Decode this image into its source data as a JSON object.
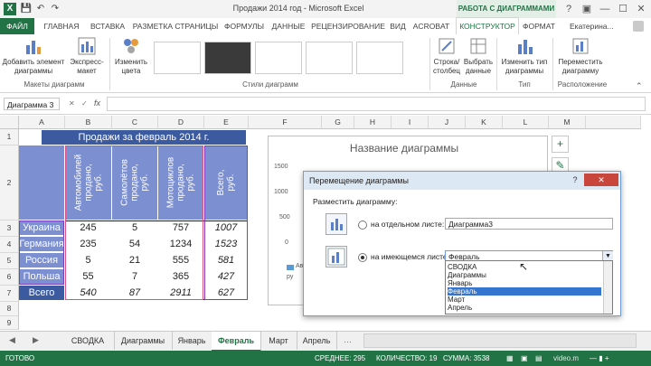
{
  "title_bar": {
    "app_icon": "X",
    "doc_title": "Продажи 2014 год - Microsoft Excel",
    "tools_title": "РАБОТА С ДИАГРАММАМИ",
    "help_icon": "?",
    "minimize_icon": "—",
    "maximize_icon": "☐",
    "close_icon": "✕"
  },
  "ribbon_tabs": [
    "ФАЙЛ",
    "ГЛАВНАЯ",
    "ВСТАВКА",
    "РАЗМЕТКА СТРАНИЦЫ",
    "ФОРМУЛЫ",
    "ДАННЫЕ",
    "РЕЦЕНЗИРОВАНИЕ",
    "ВИД",
    "ACROBAT",
    "КОНСТРУКТОР",
    "ФОРМАТ"
  ],
  "user_name": "Екатерина...",
  "ribbon": {
    "add_element": "Добавить элемент диаграммы",
    "express_layout": "Экспресс-макет",
    "change_colors": "Изменить цвета",
    "row_col": "Строка/ столбец",
    "select_data": "Выбрать данные",
    "change_type": "Изменить тип диаграммы",
    "move_chart": "Переместить диаграмму",
    "groups": {
      "layouts": "Макеты диаграмм",
      "styles": "Стили диаграмм",
      "data": "Данные",
      "type": "Тип",
      "location": "Расположение"
    }
  },
  "formula_bar": {
    "name_box": "Диаграмма 3",
    "fx": "fx"
  },
  "columns": [
    "A",
    "B",
    "C",
    "D",
    "E",
    "F",
    "G",
    "H",
    "I",
    "J",
    "K",
    "L",
    "M"
  ],
  "rows": [
    "1",
    "2",
    "3",
    "4",
    "5",
    "6",
    "7",
    "8",
    "9",
    "10",
    "11",
    "12"
  ],
  "table": {
    "title": "Продажи за февраль 2014 г.",
    "headers": [
      "Автомобилей\nпродано,\nруб.",
      "Самолётов\nпродано,\nруб.",
      "Мотоциклов\nпродано,\nруб.",
      "Всего,\nруб."
    ],
    "rows": [
      {
        "label": "Украина",
        "values": [
          "245",
          "5",
          "757",
          "1007"
        ]
      },
      {
        "label": "Германия",
        "values": [
          "235",
          "54",
          "1234",
          "1523"
        ]
      },
      {
        "label": "Россия",
        "values": [
          "5",
          "21",
          "555",
          "581"
        ]
      },
      {
        "label": "Польша",
        "values": [
          "55",
          "7",
          "365",
          "427"
        ]
      },
      {
        "label": "Всего",
        "values": [
          "540",
          "87",
          "2911",
          "627"
        ]
      }
    ]
  },
  "chart": {
    "title": "Название диаграммы",
    "y_ticks": [
      "1500",
      "1000",
      "500",
      "0"
    ],
    "legend_partial": "Ав",
    "legend_partial2": "ру"
  },
  "dialog": {
    "title": "Перемещение диаграммы",
    "help": "?",
    "close": "✕",
    "place_label": "Разместить диаграмму:",
    "new_sheet_label": "на отдельном листе:",
    "new_sheet_value": "Диаграмма3",
    "existing_label": "на имеющемся листе:",
    "existing_value": "Февраль",
    "options": [
      "СВОДКА",
      "Диаграммы",
      "Январь",
      "Февраль",
      "Март",
      "Апрель"
    ],
    "selected_option": "Февраль"
  },
  "sheet_tabs": [
    "СВОДКА",
    "Диаграммы",
    "Январь",
    "Февраль",
    "Март",
    "Апрель"
  ],
  "active_sheet": "Февраль",
  "status": {
    "ready": "ГОТОВО",
    "average": "СРЕДНЕЕ: 295",
    "count": "КОЛИЧЕСТВО: 19",
    "sum": "СУММА: 3538",
    "watermark": "video.m"
  },
  "colors": {
    "excel_green": "#217346",
    "table_header": "#7c8fd0",
    "table_title": "#3b5aa0",
    "selection": "#3375cf"
  }
}
